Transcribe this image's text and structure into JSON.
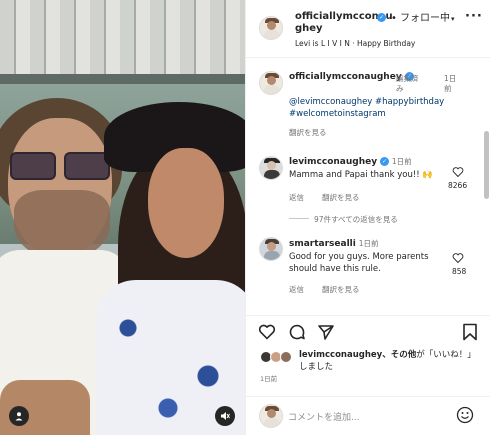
{
  "post": {
    "username_line1": "officiallymcconau",
    "username_line2": "ghey",
    "follow_label": "フォロー中",
    "audio": "Levi is L I V I N · Happy Birthday"
  },
  "caption": {
    "username": "officiallymcconaughey",
    "edited": "編集済",
    "edited_cont": "み",
    "time": "1日",
    "time_cont": "前",
    "text": "@levimcconaughey #happybirthday #welcometoinstagram",
    "translate": "翻訳を見る"
  },
  "comments": [
    {
      "username": "levimcconaughey",
      "time": "1日前",
      "text": "Mamma and Papai thank you!! 🙌",
      "likes": "8266",
      "reply": "返信",
      "translate": "翻訳を見る",
      "view_replies": "97件すべての返信を見る"
    },
    {
      "username": "smartarseallі",
      "time": "1日前",
      "text": "Good for you guys. More parents should have this rule.",
      "likes": "858",
      "reply": "返信",
      "translate": "翻訳を見る"
    }
  ],
  "likes": {
    "user": "levimcconaughey",
    "text_a": "、その他",
    "text_b": "が「いいね！」しました"
  },
  "timestamp": "1日前",
  "add_comment": "コメントを追加...",
  "colors": {
    "verified": "#3897f0",
    "link": "#00376b",
    "muted": "#737373"
  }
}
